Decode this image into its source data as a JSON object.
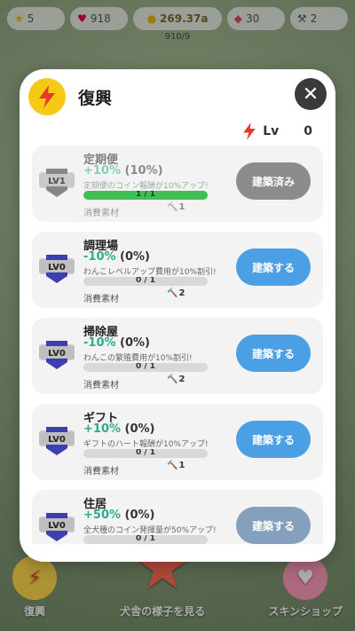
{
  "background": {
    "stats": [
      "5",
      "918",
      "269.37a",
      "30",
      "2"
    ],
    "substat": "910/9",
    "bottom": {
      "left_label": "復興",
      "center_label": "犬舎の様子を見る",
      "right_label": "スキンショップ"
    }
  },
  "modal": {
    "title": "復興",
    "lv_label": "Lv",
    "lv_value": "0",
    "materials_label": "消費素材"
  },
  "items": [
    {
      "level": "LV1",
      "name": "定期便",
      "effect_value": "+10%",
      "effect_paren": "(10%)",
      "description": "定期便のコイン報酬が10%アップ!",
      "progress_text": "1 / 1",
      "progress": 1.0,
      "material_count": "1",
      "button_label": "建築済み",
      "button_state": "built"
    },
    {
      "level": "LV0",
      "name": "調理場",
      "effect_value": "-10%",
      "effect_paren": "(0%)",
      "description": "わんこレベルアップ費用が10%割引!",
      "progress_text": "0 / 1",
      "progress": 0.0,
      "material_count": "2",
      "button_label": "建築する",
      "button_state": "build"
    },
    {
      "level": "LV0",
      "name": "掃除屋",
      "effect_value": "-10%",
      "effect_paren": "(0%)",
      "description": "わんこの繁殖費用が10%割引!",
      "progress_text": "0 / 1",
      "progress": 0.0,
      "material_count": "2",
      "button_label": "建築する",
      "button_state": "build"
    },
    {
      "level": "LV0",
      "name": "ギフト",
      "effect_value": "+10%",
      "effect_paren": "(0%)",
      "description": "ギフトのハート報酬が10%アップ!",
      "progress_text": "0 / 1",
      "progress": 0.0,
      "material_count": "1",
      "button_label": "建築する",
      "button_state": "build"
    },
    {
      "level": "LV0",
      "name": "住居",
      "effect_value": "+50%",
      "effect_paren": "(0%)",
      "description": "全犬種のコイン発揮量が50%アップ!",
      "progress_text": "0 / 1",
      "progress": 0.0,
      "material_count": "",
      "button_label": "建築する",
      "button_state": "disabled"
    }
  ]
}
